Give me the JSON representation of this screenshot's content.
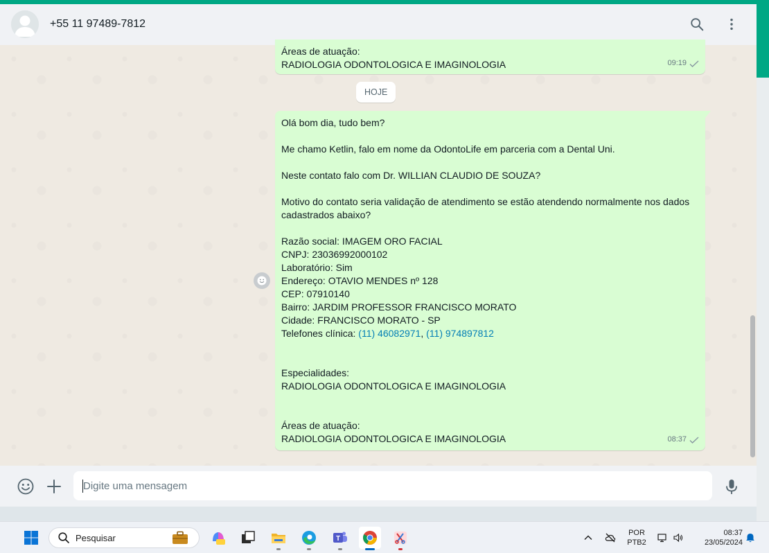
{
  "header": {
    "contact": "+55 11 97489-7812",
    "search_icon": "search-icon",
    "menu_icon": "more-vertical-icon"
  },
  "previous_message": {
    "lines": [
      "Áreas de atuação:",
      "RADIOLOGIA ODONTOLOGICA E IMAGINOLOGIA"
    ],
    "time": "09:19"
  },
  "date_separator": "HOJE",
  "main_message": {
    "lines": [
      "Olá bom dia, tudo bem?",
      "",
      "Me chamo Ketlin, falo em nome da OdontoLife em parceria com a Dental Uni.",
      "",
      "Neste contato falo com Dr. WILLIAN CLAUDIO DE SOUZA?",
      "",
      "Motivo do contato seria validação de atendimento se estão atendendo normalmente nos dados cadastrados abaixo?",
      "",
      "Razão social: IMAGEM ORO FACIAL",
      "CNPJ: 23036992000102",
      "Laboratório: Sim",
      "Endereço: OTAVIO MENDES nº 128",
      "CEP: 07910140",
      "Bairro: JARDIM PROFESSOR FRANCISCO MORATO",
      "Cidade: FRANCISCO MORATO - SP"
    ],
    "phones_label": "Telefones clínica: ",
    "phone_1": "(11) 46082971",
    "phone_sep": ", ",
    "phone_2": "(11) 974897812",
    "lines_after": [
      "",
      "",
      "Especialidades:",
      "RADIOLOGIA ODONTOLOGICA E IMAGINOLOGIA",
      "",
      "",
      "Áreas de atuação:",
      "RADIOLOGIA ODONTOLOGICA E IMAGINOLOGIA"
    ],
    "time": "08:37"
  },
  "composer": {
    "placeholder": "Digite uma mensagem"
  },
  "taskbar": {
    "search_label": "Pesquisar",
    "lang_top": "POR",
    "lang_bottom": "PTB2",
    "clock_time": "08:37",
    "clock_date": "23/05/2024"
  },
  "colors": {
    "accent": "#00a884",
    "outgoing_bubble": "#d9fdd3",
    "link": "#027eb5"
  }
}
